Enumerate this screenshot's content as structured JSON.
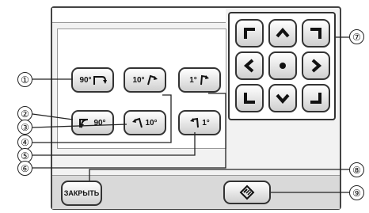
{
  "rotation_buttons": {
    "cw_90": "90°",
    "cw_10": "10°",
    "cw_1": "1°",
    "ccw_90": "90°",
    "ccw_10": "10°",
    "ccw_1": "1°"
  },
  "bottom_bar": {
    "close_label": "ЗАКРЫТЬ"
  },
  "callouts": [
    "①",
    "②",
    "③",
    "④",
    "⑤",
    "⑥",
    "⑦",
    "⑧",
    "⑨"
  ],
  "colors": {
    "panel": "#f2f2f2",
    "button_top": "#ffffff",
    "button_bottom": "#cfcfcf",
    "outline": "#333333"
  },
  "icons": {
    "cw_arrow": "rotate-clockwise-icon",
    "ccw_arrow": "rotate-counterclockwise-icon",
    "directional": [
      "arrow-up-left-icon",
      "arrow-up-icon",
      "arrow-up-right-icon",
      "arrow-left-icon",
      "center-dot-icon",
      "arrow-right-icon",
      "arrow-down-left-icon",
      "arrow-down-icon",
      "arrow-down-right-icon"
    ],
    "reset": "reset-rotate-icon"
  }
}
